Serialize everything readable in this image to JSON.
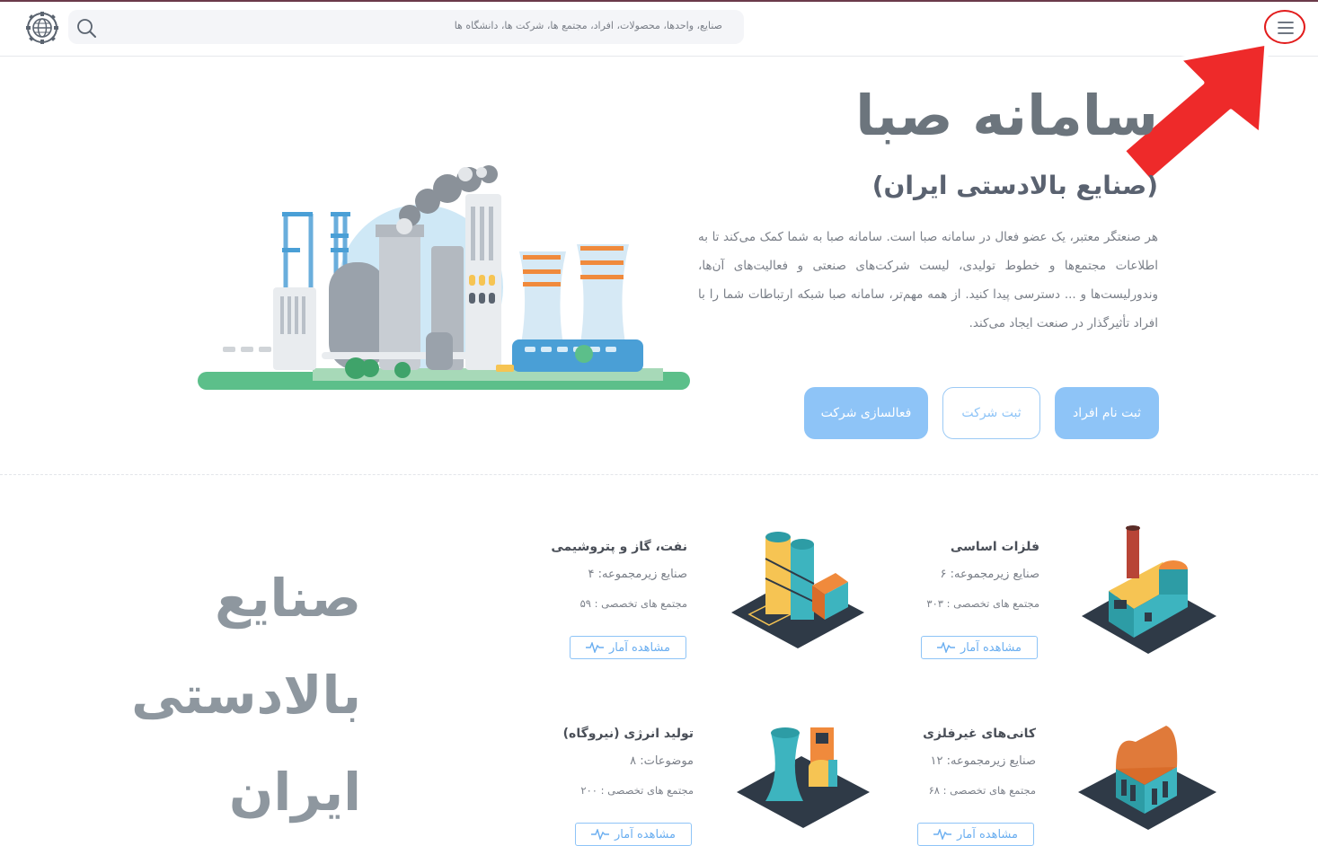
{
  "header": {
    "search_placeholder": "صنایع، واحدها، محصولات، افراد، مجتمع ها، شرکت ها، دانشگاه ها",
    "logo_icon": "globe-gear-icon",
    "search_icon": "search-icon",
    "menu_icon": "hamburger-menu-icon"
  },
  "hero": {
    "title": "سامانه صبا",
    "subtitle": "(صنایع بالادستی ایران)",
    "body": "هر صنعتگر معتبر، یک عضو فعال در سامانه صبا است. سامانه صبا به شما کمک می‌کند تا به اطلاعات مجتمع‌ها و خطوط تولیدی، لیست شرکت‌های صنعتی و فعالیت‌های آن‌ها، وندورلیست‌ها و ... دسترسی پیدا کنید. از همه مهم‌تر، سامانه صبا شبکه ارتباطات شما را با افراد تأثیرگذار در صنعت ایجاد می‌کند.",
    "buttons": {
      "register_people": "ثبت نام افراد",
      "register_company": "ثبت شرکت",
      "activate_company": "فعالسازی شرکت"
    }
  },
  "industries": {
    "title": "صنایع بالادستی ایران",
    "stats_label": "مشاهده آمار",
    "cards": [
      {
        "title": "فلزات اساسی",
        "line1": "صنایع زیرمجموعه: ۶",
        "line2": "مجتمع های تخصصی : ۳۰۳"
      },
      {
        "title": "نفت، گاز و پتروشیمی",
        "line1": "صنایع زیرمجموعه: ۴",
        "line2": "مجتمع های تخصصی : ۵۹"
      },
      {
        "title": "کانی‌های غیرفلزی",
        "line1": "صنایع زیرمجموعه: ۱۲",
        "line2": "مجتمع های تخصصی : ۶۸"
      },
      {
        "title": "تولید انرژی (نیروگاه)",
        "line1": "موضوعات: ۸",
        "line2": "مجتمع های تخصصی : ۲۰۰"
      }
    ]
  },
  "colors": {
    "primary": "#8ec4f7",
    "annotation_red": "#e21c1c",
    "title_gray": "#6c757d"
  }
}
